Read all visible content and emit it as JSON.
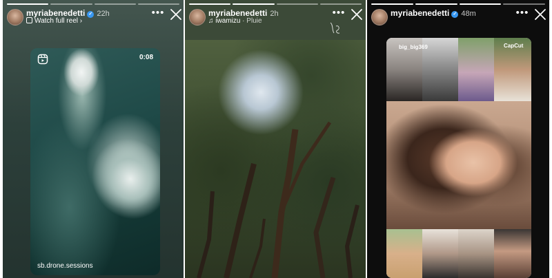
{
  "stories": [
    {
      "username": "myriabenedetti",
      "time": "22h",
      "subline": "Watch full reel",
      "reel_duration": "0:08",
      "reel_credit": "sb.drone.sessions",
      "progress_segments": 4,
      "progress_done": 1
    },
    {
      "username": "myriabenedetti",
      "time": "2h",
      "sub_user": "iwamizu",
      "sub_song": "Pluie",
      "progress_segments": 4,
      "progress_done": 2
    },
    {
      "username": "myriabenedetti",
      "time": "48m",
      "collage_tag_left": "big_big369",
      "collage_tag_right": "CapCut",
      "progress_segments": 4,
      "progress_done": 3
    }
  ],
  "icons": {
    "verified": "verified-badge-icon",
    "more": "more-options-icon",
    "close": "close-icon",
    "reel": "reel-icon"
  },
  "colors": {
    "verified_blue": "#3897f0",
    "text": "#ffffff"
  }
}
